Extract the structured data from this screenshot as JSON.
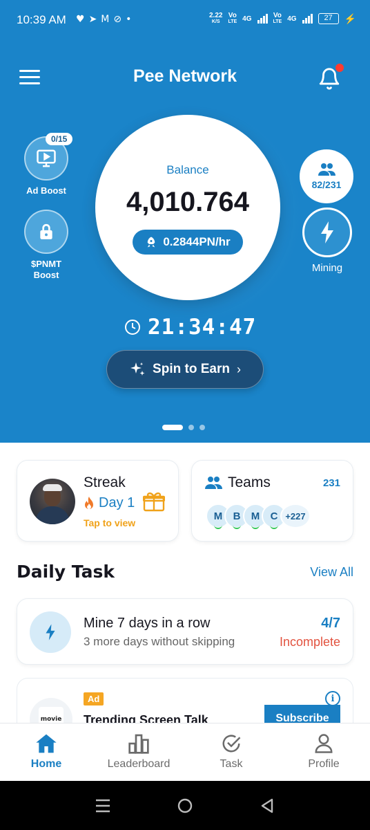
{
  "status_bar": {
    "time": "10:39 AM",
    "left_icons": [
      "heart-icon",
      "telegram-icon",
      "gmail-icon",
      "link-icon",
      "dot-icon"
    ],
    "net_speed": "2.22",
    "net_unit": "K/S",
    "sim1_label_top": "Vo",
    "sim1_label_bottom": "LTE",
    "sim1_network": "4G",
    "sim2_label_top": "Vo",
    "sim2_label_bottom": "LTE",
    "sim2_network": "4G",
    "battery": "27"
  },
  "header": {
    "title": "Pee Network"
  },
  "ad_boost": {
    "badge": "0/15",
    "label": "Ad Boost"
  },
  "pnmt_boost": {
    "label_line1": "$PNMT",
    "label_line2": "Boost"
  },
  "team_circle": {
    "count": "82/231"
  },
  "mining": {
    "label": "Mining"
  },
  "balance": {
    "label": "Balance",
    "value": "4,010.764",
    "rate": "0.2844PN/hr"
  },
  "timer": {
    "value": "21:34:47"
  },
  "spin": {
    "label": "Spin to Earn"
  },
  "carousel": {
    "pages": 3,
    "active_index": 0
  },
  "streak_card": {
    "title": "Streak",
    "day": "Day 1",
    "cta": "Tap to view"
  },
  "teams_card": {
    "title": "Teams",
    "count": "231",
    "members": [
      "M",
      "B",
      "M",
      "C"
    ],
    "more": "+227"
  },
  "daily_task": {
    "title": "Daily Task",
    "view_all": "View All"
  },
  "task": {
    "title": "Mine 7 days in a row",
    "subtitle": "3 more days without skipping",
    "progress": "4/7",
    "status": "Incomplete"
  },
  "ad": {
    "tag": "Ad",
    "logo_text": "movie",
    "title": "Trending Screen Talk",
    "info": "i",
    "cta": "Subscribe"
  },
  "bottom_nav": {
    "items": [
      {
        "label": "Home",
        "icon": "home-icon"
      },
      {
        "label": "Leaderboard",
        "icon": "bar-chart-icon"
      },
      {
        "label": "Task",
        "icon": "check-circle-icon"
      },
      {
        "label": "Profile",
        "icon": "person-icon"
      }
    ],
    "active": "Home"
  },
  "colors": {
    "primary": "#1a84c9",
    "accent_blue": "#1a7fc3",
    "spin_button": "#1c4d78",
    "streak_orange": "#f0a21a",
    "incomplete_red": "#e2523f",
    "notification_dot": "#ff3b30"
  }
}
